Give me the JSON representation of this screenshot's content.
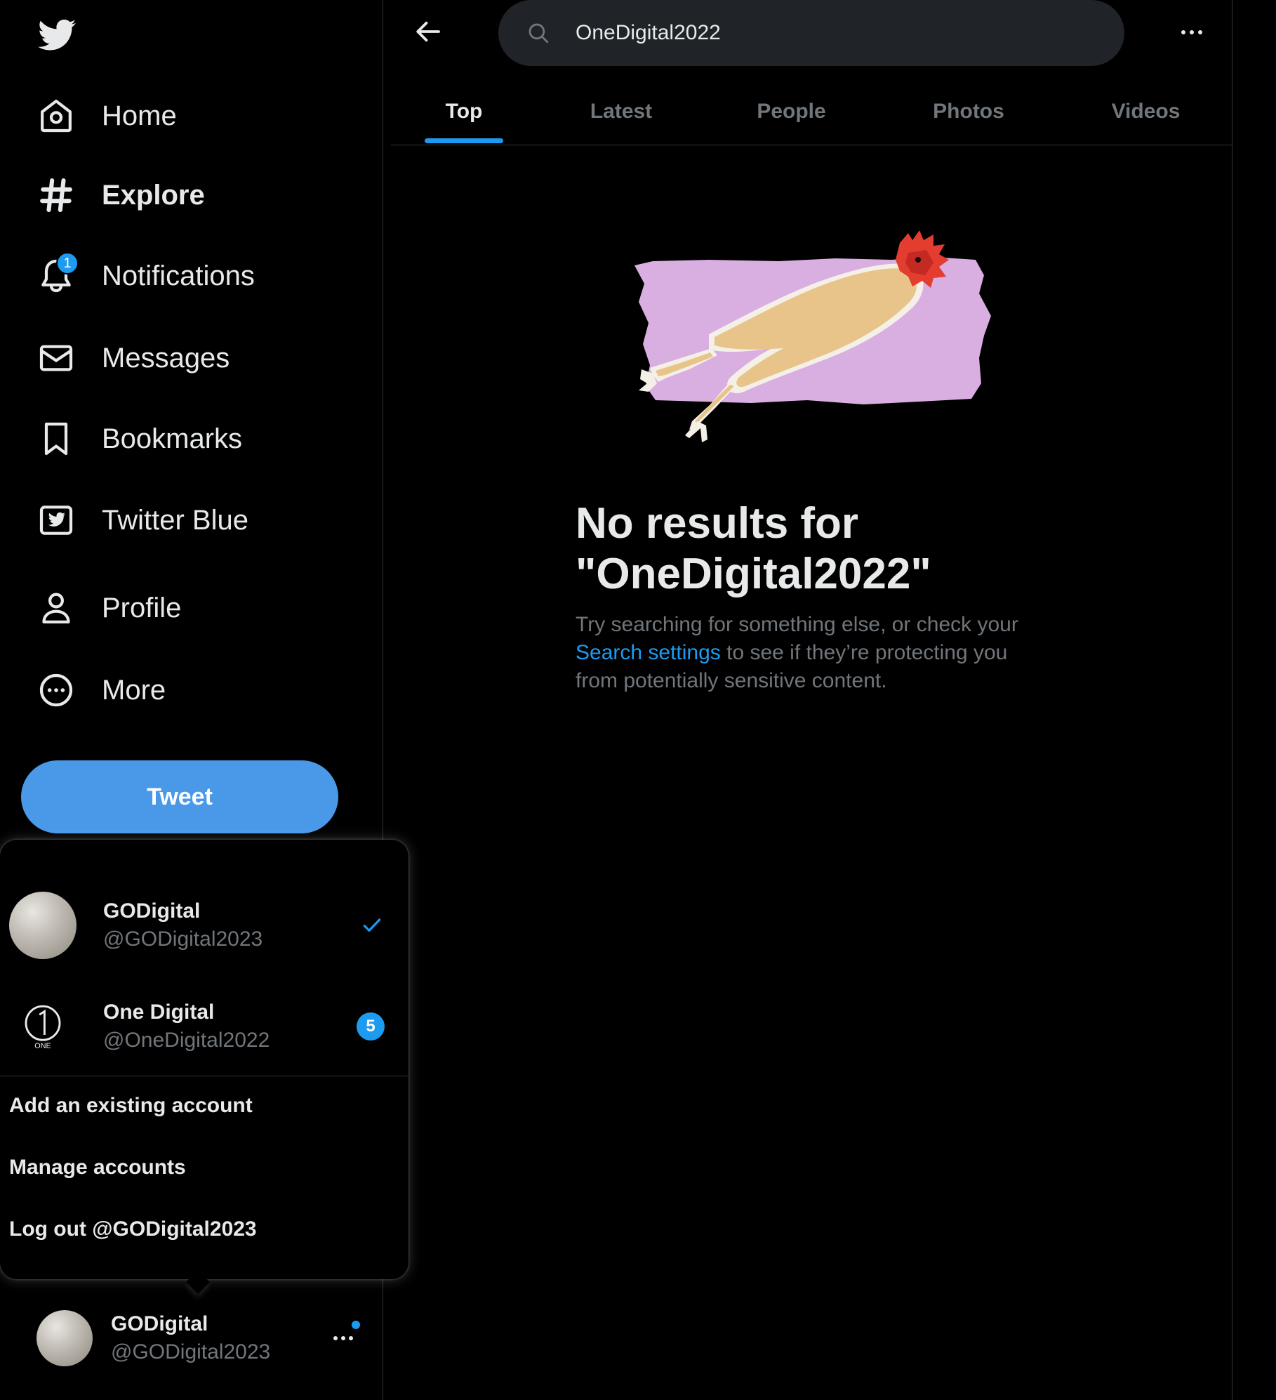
{
  "sidebar": {
    "logo": "twitter-bird-icon",
    "items": [
      {
        "label": "Home",
        "icon": "home-icon"
      },
      {
        "label": "Explore",
        "icon": "hashtag-icon"
      },
      {
        "label": "Notifications",
        "icon": "bell-icon",
        "badge": "1"
      },
      {
        "label": "Messages",
        "icon": "envelope-icon"
      },
      {
        "label": "Bookmarks",
        "icon": "bookmark-icon"
      },
      {
        "label": "Twitter Blue",
        "icon": "twitter-blue-icon"
      },
      {
        "label": "Profile",
        "icon": "person-icon"
      },
      {
        "label": "More",
        "icon": "more-circle-icon"
      }
    ],
    "tweet_label": "Tweet"
  },
  "account_menu": {
    "accounts": [
      {
        "name": "GODigital",
        "handle": "@GODigital2023",
        "active": true
      },
      {
        "name": "One Digital",
        "handle": "@OneDigital2022",
        "badge": "5"
      }
    ],
    "onedigital_logo_text": "ONE",
    "links": {
      "add": "Add an existing account",
      "manage": "Manage accounts",
      "logout": "Log out @GODigital2023"
    }
  },
  "current_account": {
    "name": "GODigital",
    "handle": "@GODigital2023"
  },
  "search": {
    "value": "OneDigital2022"
  },
  "tabs": [
    "Top",
    "Latest",
    "People",
    "Photos",
    "Videos"
  ],
  "empty_state": {
    "title": "No results for \"OneDigital2022\"",
    "desc_before": "Try searching for something else, or check your ",
    "link": "Search settings",
    "desc_after": " to see if they’re protecting you from potentially sensitive content."
  },
  "colors": {
    "accent": "#1d9bf0",
    "tweet_button": "#4a99e9",
    "background": "#000000",
    "muted": "#71767b",
    "illustration_bg": "#d9aee0"
  }
}
